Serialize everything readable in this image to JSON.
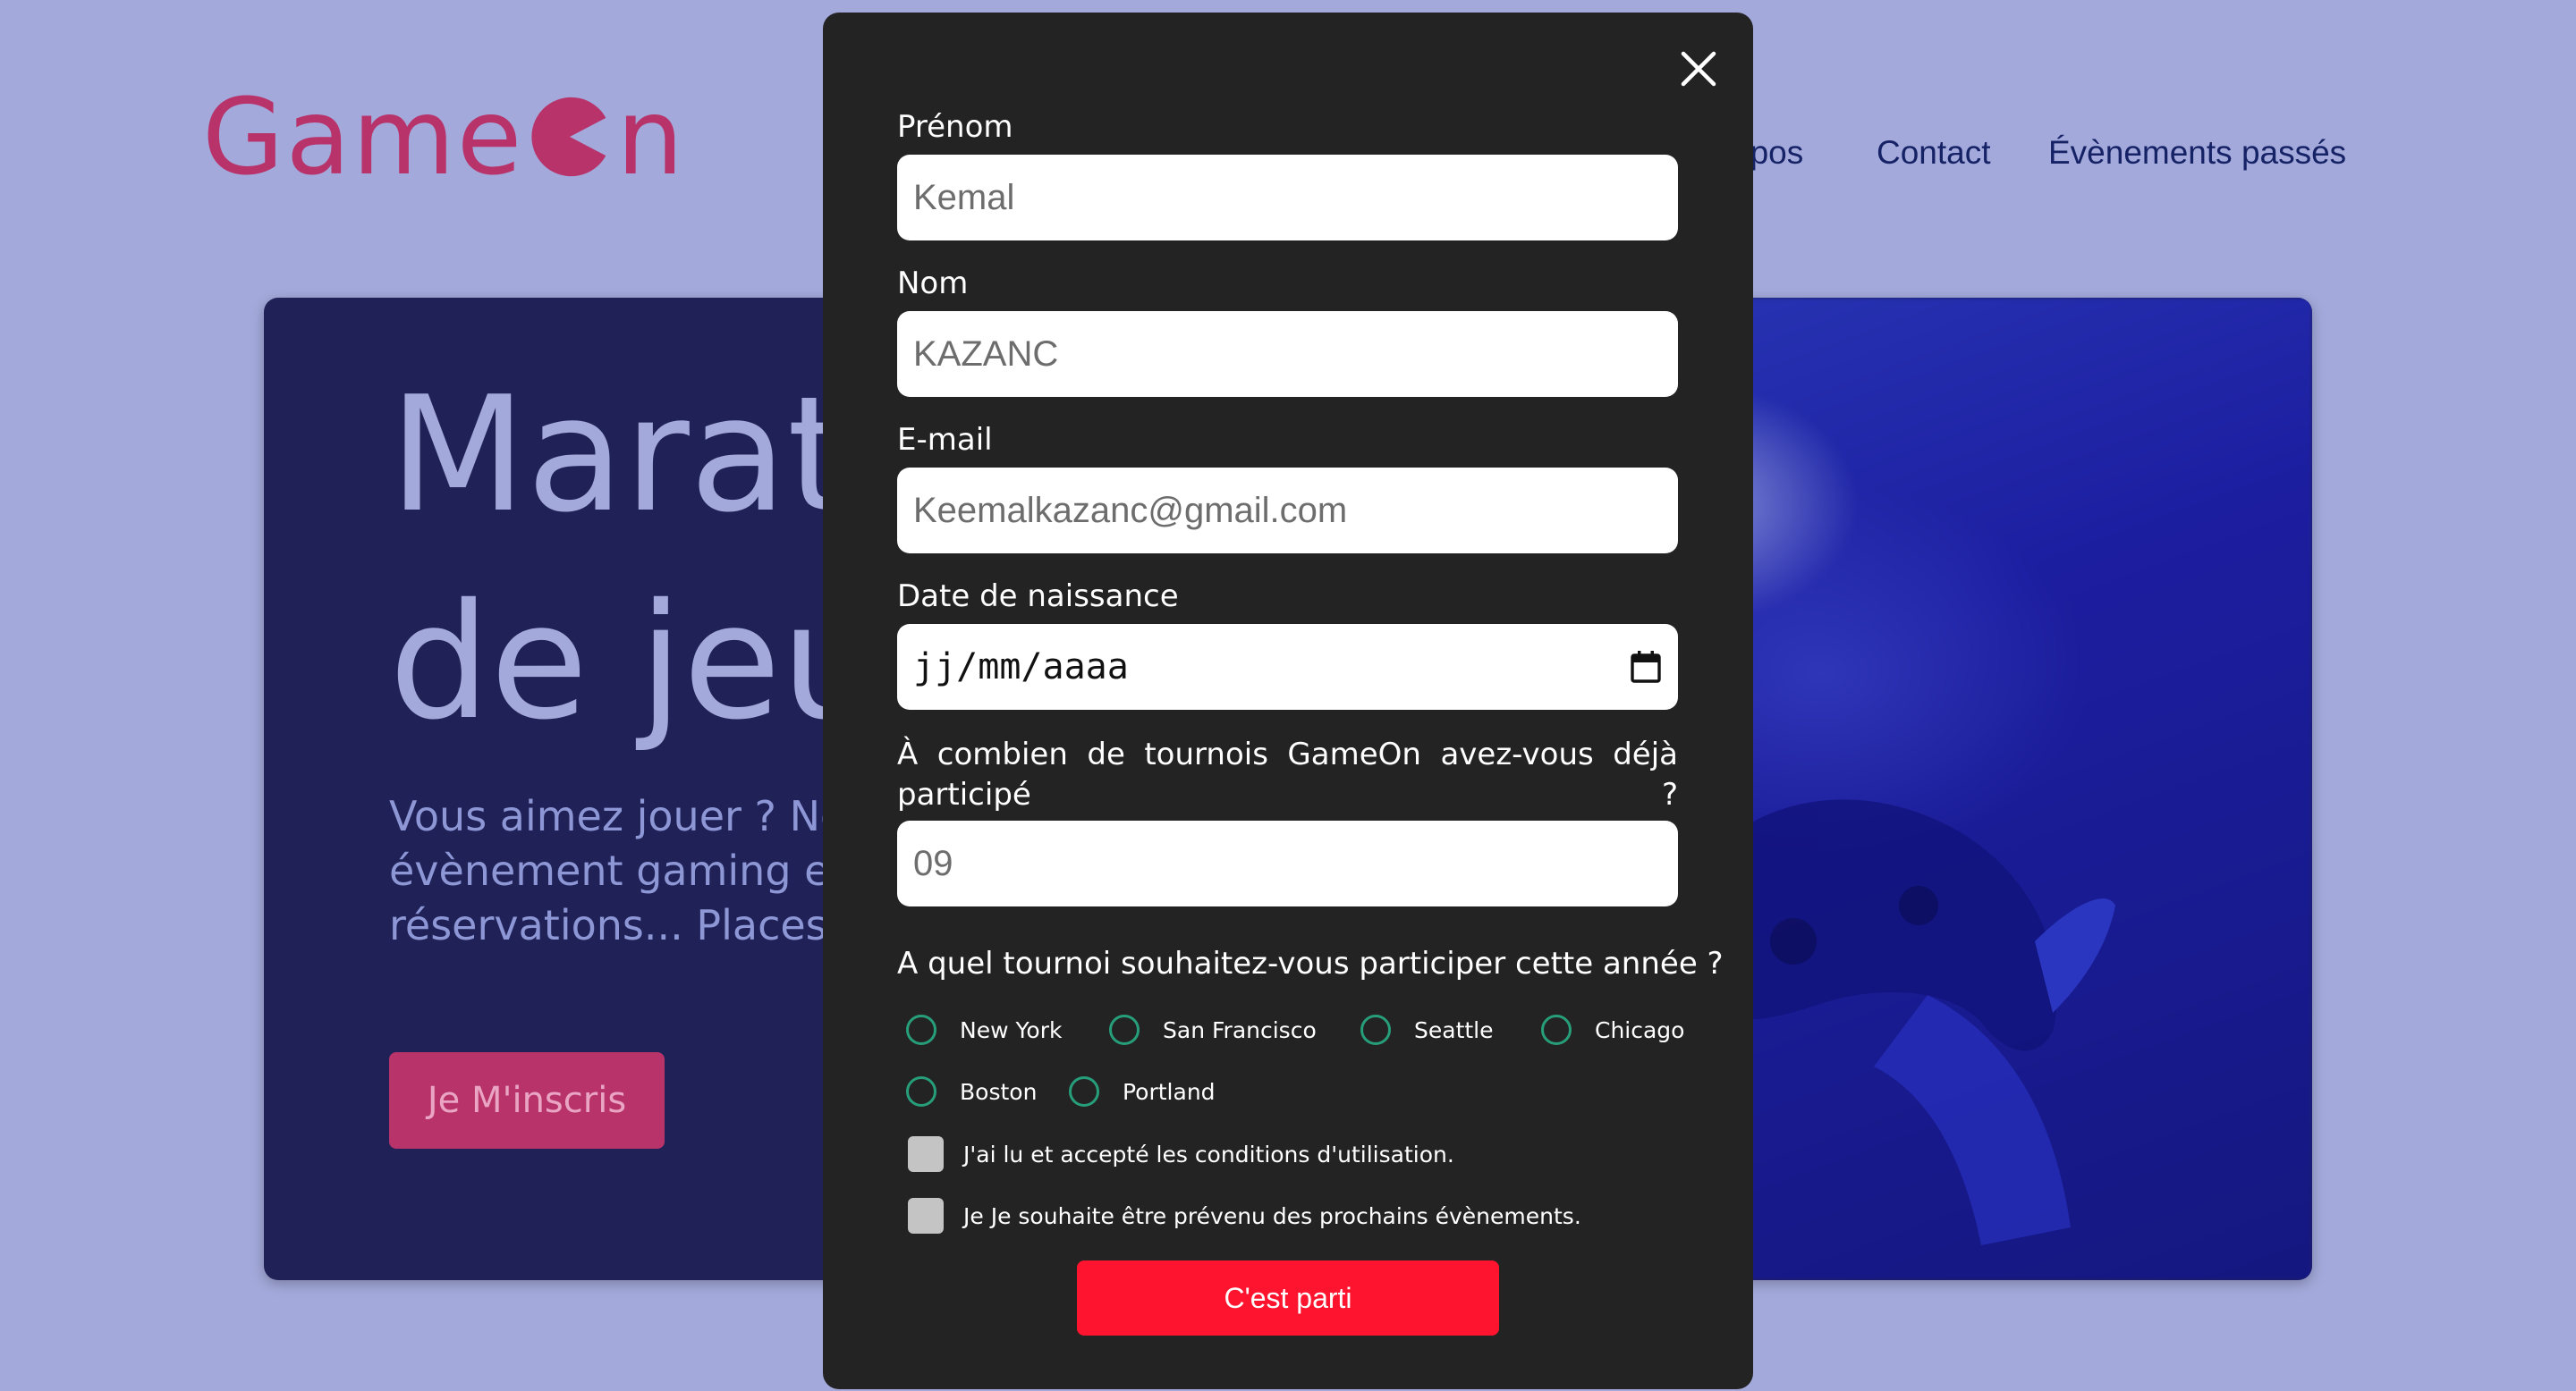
{
  "brand": {
    "name_part1": "Game",
    "name_part2": "n",
    "color": "#b8336a"
  },
  "nav": {
    "items": [
      "opos",
      "Contact",
      "Évènements passés"
    ]
  },
  "hero": {
    "title_line1": "Marat",
    "title_line2": "de jeu",
    "text_line1": "Vous aimez jouer ? Not",
    "text_line2": "évènement gaming est",
    "text_line3": "réservations... Places li",
    "button_label": "Je M'inscris"
  },
  "modal": {
    "close_icon": "close-icon",
    "fields": {
      "first_name": {
        "label": "Prénom",
        "value": "Kemal"
      },
      "last_name": {
        "label": "Nom",
        "value": "KAZANC"
      },
      "email": {
        "label": "E-mail",
        "value": "Keemalkazanc@gmail.com"
      },
      "birthdate": {
        "label": "Date de naissance",
        "placeholder": "jj/mm/aaaa",
        "icon": "calendar-icon"
      },
      "tournaments": {
        "label": "À combien de tournois GameOn avez-vous déjà participé ?",
        "value": "09"
      }
    },
    "location_question": "A quel tournoi souhaitez-vous participer cette année ?",
    "locations": [
      "New York",
      "San Francisco",
      "Seattle",
      "Chicago",
      "Boston",
      "Portland"
    ],
    "checkboxes": {
      "terms": "J'ai lu et accepté les conditions d'utilisation.",
      "newsletter": "Je Je souhaite être prévenu des prochains évènements."
    },
    "submit_label": "C'est parti",
    "colors": {
      "background": "#232323",
      "radio": "#279e7a",
      "submit": "#fe142f"
    }
  }
}
